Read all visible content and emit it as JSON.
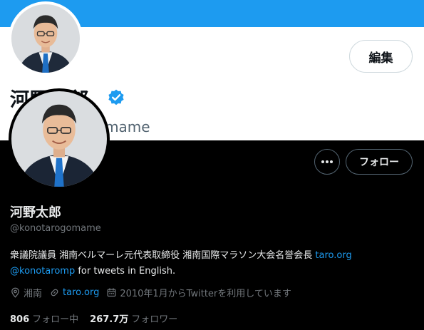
{
  "light": {
    "edit_label": "編集",
    "name": "河野太郎",
    "handle": "@konotarogomame"
  },
  "profile": {
    "name": "河野太郎",
    "handle": "@konotarogomame",
    "more_label": "•••",
    "follow_label": "フォロー",
    "bio_line1": "衆議院議員 湘南ベルマーレ元代表取締役 湘南国際マラソン大会名誉会長 ",
    "bio_link1": "taro.org",
    "bio_mention": "@konotaromp",
    "bio_line2_rest": " for tweets in English.",
    "location": "湘南",
    "website": "taro.org",
    "joined": "2010年1月からTwitterを利用しています",
    "following_count": "806",
    "following_label": "フォロー中",
    "followers_count": "267.7万",
    "followers_label": "フォロワー"
  },
  "colors": {
    "accent": "#1d9bf0",
    "text_primary_dark": "#e7e9ea",
    "text_secondary_dark": "#71767b",
    "banner": "#1d9bf0"
  },
  "icons": {
    "verified": "verified-badge-icon",
    "more": "ellipsis-icon",
    "location": "location-pin-icon",
    "link": "link-icon",
    "calendar": "calendar-icon"
  }
}
